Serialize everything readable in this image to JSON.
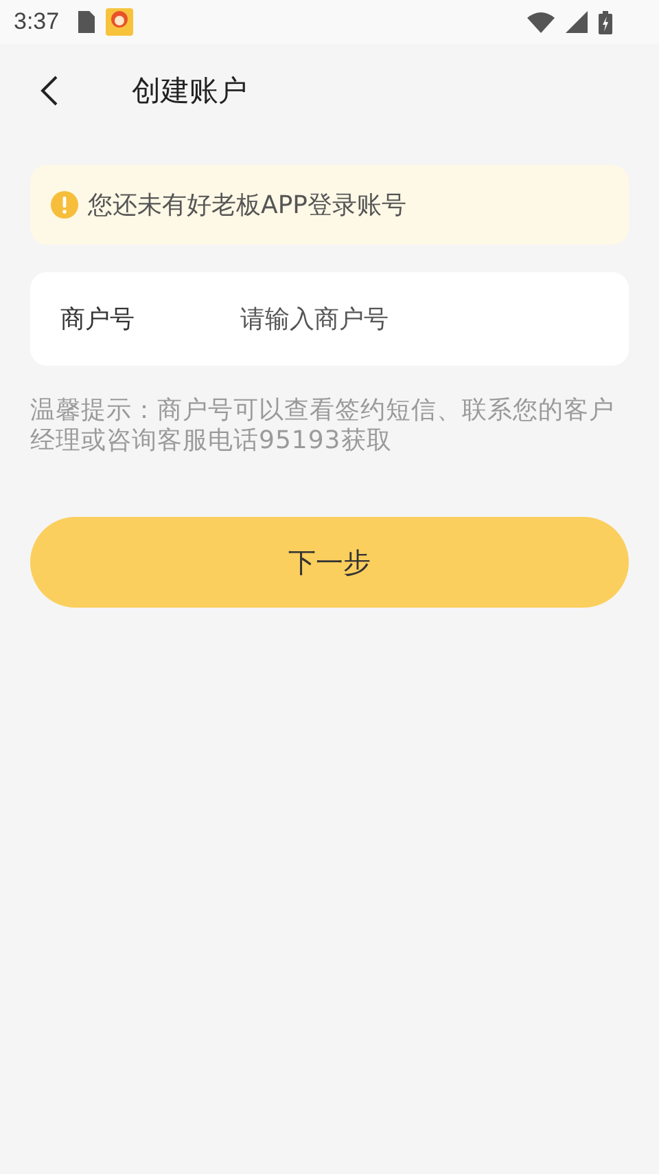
{
  "status_bar": {
    "time": "3:37"
  },
  "header": {
    "title": "创建账户"
  },
  "notice": {
    "text": "您还未有好老板APP登录账号"
  },
  "field": {
    "label": "商户号",
    "placeholder": "请输入商户号"
  },
  "tip": "温馨提示：商户号可以查看签约短信、联系您的客户经理或咨询客服电话95193获取",
  "buttons": [
    {
      "label": "下一步"
    }
  ]
}
